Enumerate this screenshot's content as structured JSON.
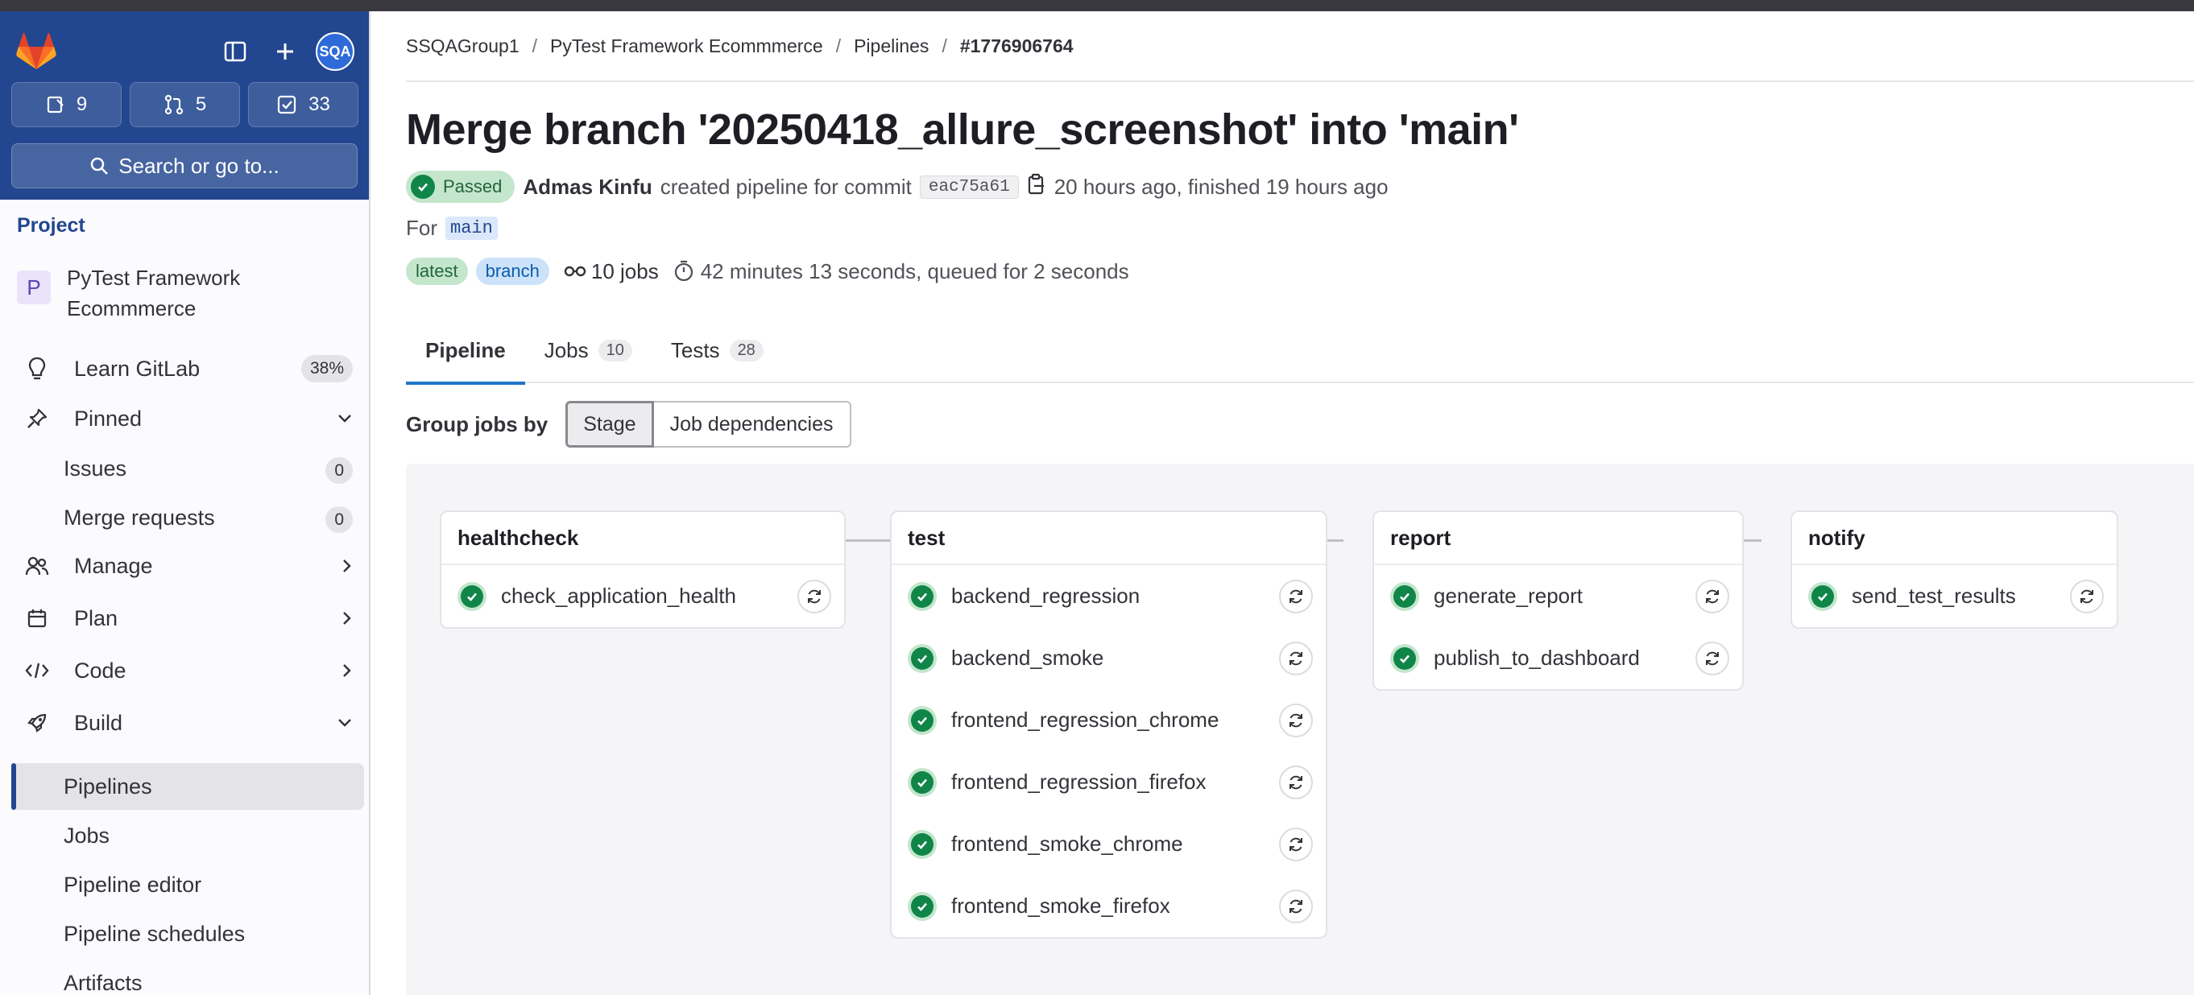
{
  "sidebar": {
    "counts": {
      "issues": "9",
      "merge_requests": "5",
      "todos": "33"
    },
    "avatar_initials": "SQA",
    "search_label": "Search or go to...",
    "section_title": "Project",
    "project": {
      "initial": "P",
      "name_line1": "PyTest Framework",
      "name_line2": "Ecommmerce"
    },
    "learn": {
      "label": "Learn GitLab",
      "progress": "38%"
    },
    "pinned": {
      "label": "Pinned"
    },
    "pinned_items": [
      {
        "label": "Issues",
        "count": "0"
      },
      {
        "label": "Merge requests",
        "count": "0"
      }
    ],
    "manage": "Manage",
    "plan": "Plan",
    "code": "Code",
    "build": "Build",
    "build_items": [
      "Pipelines",
      "Jobs",
      "Pipeline editor",
      "Pipeline schedules",
      "Artifacts"
    ]
  },
  "breadcrumb": [
    "SSQAGroup1",
    "PyTest Framework Ecommmerce",
    "Pipelines",
    "#1776906764"
  ],
  "title": "Merge branch '20250418_allure_screenshot' into 'main'",
  "meta": {
    "status": "Passed",
    "author": "Admas Kinfu",
    "action": "created pipeline for commit",
    "sha": "eac75a61",
    "time": "20 hours ago, finished 19 hours ago"
  },
  "for_row": {
    "label": "For",
    "branch": "main"
  },
  "tags": {
    "latest": "latest",
    "branch": "branch",
    "jobs": "10 jobs",
    "duration": "42 minutes 13 seconds, queued for 2 seconds"
  },
  "tabs": [
    {
      "label": "Pipeline",
      "count": ""
    },
    {
      "label": "Jobs",
      "count": "10"
    },
    {
      "label": "Tests",
      "count": "28"
    }
  ],
  "group_by": {
    "label": "Group jobs by",
    "options": [
      "Stage",
      "Job dependencies"
    ],
    "selected": "Stage"
  },
  "stages": [
    {
      "name": "healthcheck",
      "jobs": [
        "check_application_health"
      ]
    },
    {
      "name": "test",
      "jobs": [
        "backend_regression",
        "backend_smoke",
        "frontend_regression_chrome",
        "frontend_regression_firefox",
        "frontend_smoke_chrome",
        "frontend_smoke_firefox"
      ]
    },
    {
      "name": "report",
      "jobs": [
        "generate_report",
        "publish_to_dashboard"
      ]
    },
    {
      "name": "notify",
      "jobs": [
        "send_test_results"
      ]
    }
  ],
  "colors": {
    "success": "#108548",
    "sidebar_header": "#22468f",
    "tab_accent": "#1f75cb"
  }
}
